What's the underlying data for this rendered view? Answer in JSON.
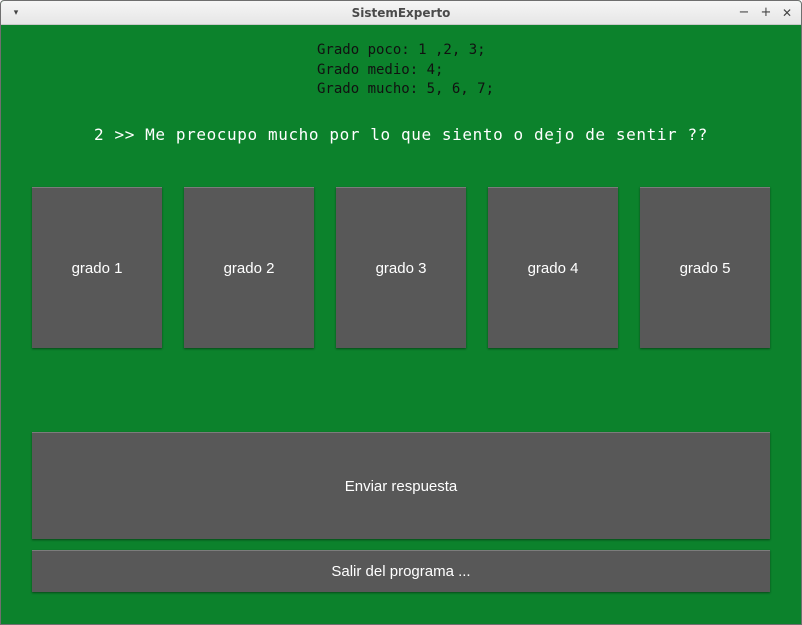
{
  "window": {
    "title": "SistemExperto",
    "controls": {
      "menu": "▾",
      "minimize": "−",
      "maximize": "+",
      "close": "✕"
    }
  },
  "scale": {
    "lines": [
      "Grado poco: 1 ,2, 3;",
      "Grado medio: 4;",
      "Grado mucho: 5, 6, 7;"
    ]
  },
  "question": "2 >> Me preocupo mucho por lo que siento o dejo de sentir ??",
  "grade_buttons": [
    "grado 1",
    "grado 2",
    "grado 3",
    "grado 4",
    "grado 5"
  ],
  "send_button": "Enviar respuesta",
  "exit_button": "Salir del programa ...",
  "colors": {
    "background": "#0c822c",
    "button": "#585858"
  }
}
